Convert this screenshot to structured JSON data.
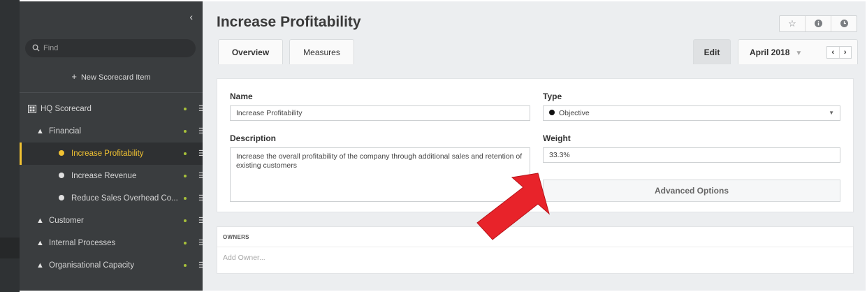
{
  "sidebar": {
    "collapse_glyph": "‹",
    "search_placeholder": "Find",
    "new_item": {
      "icon": "plus-icon",
      "label": "New Scorecard Item"
    },
    "tree": [
      {
        "label": "HQ Scorecard",
        "icon": "scorecard-icon",
        "level": 0
      },
      {
        "label": "Financial",
        "icon": "triangle-icon",
        "level": 1
      },
      {
        "label": "Increase Profitability",
        "icon": "objective-bullet-icon",
        "level": 2,
        "active": true
      },
      {
        "label": "Increase Revenue",
        "icon": "objective-bullet-icon",
        "level": 2
      },
      {
        "label": "Reduce Sales Overhead Co...",
        "icon": "objective-bullet-icon",
        "level": 2
      },
      {
        "label": "Customer",
        "icon": "triangle-icon",
        "level": 1
      },
      {
        "label": "Internal Processes",
        "icon": "triangle-icon",
        "level": 1
      },
      {
        "label": "Organisational Capacity",
        "icon": "triangle-icon",
        "level": 1
      }
    ],
    "active_color": "#f1c232",
    "status_dot_color": "#a8c23a"
  },
  "header": {
    "title": "Increase Profitability",
    "icons": [
      "star-icon",
      "info-icon",
      "clock-icon"
    ]
  },
  "tabs": [
    {
      "label": "Overview",
      "active": true
    },
    {
      "label": "Measures",
      "active": false
    }
  ],
  "toolbar": {
    "edit_label": "Edit",
    "period_label": "April 2018",
    "prev_glyph": "‹",
    "next_glyph": "›"
  },
  "form": {
    "name_label": "Name",
    "name_value": "Increase Profitability",
    "type_label": "Type",
    "type_value": "Objective",
    "description_label": "Description",
    "description_value": "Increase the overall profitability of the company through additional sales and retention of existing customers",
    "weight_label": "Weight",
    "weight_value": "33.3%",
    "advanced_label": "Advanced Options"
  },
  "owners": {
    "header": "OWNERS",
    "add_placeholder": "Add Owner..."
  },
  "annotation": {
    "arrow_color": "#e8232a"
  }
}
